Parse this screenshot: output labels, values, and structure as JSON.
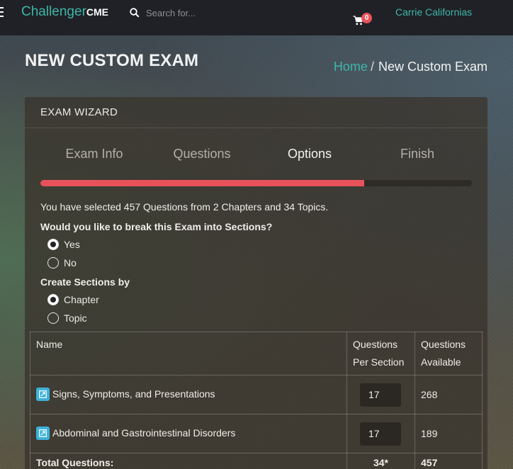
{
  "navbar": {
    "brand_main": "Challenger",
    "brand_suffix": "CME",
    "search_placeholder": "Search for...",
    "cart_count": "0",
    "user_name": "Carrie Californias",
    "icons": [
      "menu-icon",
      "search-icon",
      "cart-icon"
    ]
  },
  "page": {
    "title": "NEW CUSTOM EXAM",
    "breadcrumb_home": "Home",
    "breadcrumb_sep": "/",
    "breadcrumb_current": "New Custom Exam"
  },
  "wizard": {
    "header": "EXAM WIZARD",
    "steps": [
      {
        "label": "Exam Info",
        "active": false
      },
      {
        "label": "Questions",
        "active": false
      },
      {
        "label": "Options",
        "active": true
      },
      {
        "label": "Finish",
        "active": false
      }
    ],
    "progress_fraction": 0.75,
    "colors": {
      "accent": "#3fb5a8",
      "progress": "#e8525a",
      "edit_badge": "#3eb1d8"
    },
    "summary": "You have selected 457 Questions from 2 Chapters and 34 Topics.",
    "break_question": "Would you like to break this Exam into Sections?",
    "break_options": [
      {
        "label": "Yes",
        "selected": true
      },
      {
        "label": "No",
        "selected": false
      }
    ],
    "section_question": "Create Sections by",
    "section_options": [
      {
        "label": "Chapter",
        "selected": true
      },
      {
        "label": "Topic",
        "selected": false
      }
    ]
  },
  "table": {
    "headers": {
      "name": "Name",
      "per_section_1": "Questions",
      "per_section_2": "Per Section",
      "available_1": "Questions",
      "available_2": "Available"
    },
    "rows": [
      {
        "name": "Signs, Symptoms, and Presentations",
        "per_section": "17",
        "available": "268"
      },
      {
        "name": "Abdominal and Gastrointestinal Disorders",
        "per_section": "17",
        "available": "189"
      }
    ],
    "total_label": "Total Questions:",
    "total_per_section": "34*",
    "total_available": "457"
  }
}
